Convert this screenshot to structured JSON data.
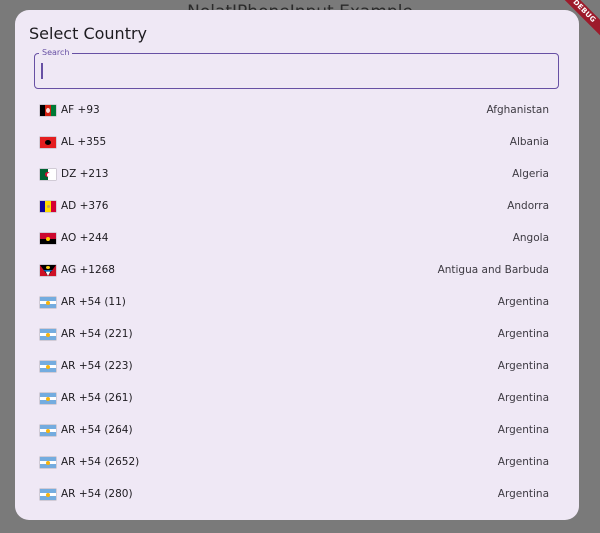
{
  "background": {
    "title": "NolatIPhoneInput Example"
  },
  "debug_banner": {
    "label": "DEBUG"
  },
  "dialog": {
    "title": "Select Country",
    "search": {
      "label": "Search",
      "value": "",
      "placeholder": ""
    },
    "countries": [
      {
        "code": "AF +93",
        "name": "Afghanistan",
        "flag": "af"
      },
      {
        "code": "AL +355",
        "name": "Albania",
        "flag": "al"
      },
      {
        "code": "DZ +213",
        "name": "Algeria",
        "flag": "dz"
      },
      {
        "code": "AD +376",
        "name": "Andorra",
        "flag": "ad"
      },
      {
        "code": "AO +244",
        "name": "Angola",
        "flag": "ao"
      },
      {
        "code": "AG +1268",
        "name": "Antigua and Barbuda",
        "flag": "ag"
      },
      {
        "code": "AR +54 (11)",
        "name": "Argentina",
        "flag": "ar"
      },
      {
        "code": "AR +54 (221)",
        "name": "Argentina",
        "flag": "ar"
      },
      {
        "code": "AR +54 (223)",
        "name": "Argentina",
        "flag": "ar"
      },
      {
        "code": "AR +54 (261)",
        "name": "Argentina",
        "flag": "ar"
      },
      {
        "code": "AR +54 (264)",
        "name": "Argentina",
        "flag": "ar"
      },
      {
        "code": "AR +54 (2652)",
        "name": "Argentina",
        "flag": "ar"
      },
      {
        "code": "AR +54 (280)",
        "name": "Argentina",
        "flag": "ar"
      }
    ]
  },
  "colors": {
    "scrim": "#7a7a7a",
    "dialog_surface": "#efe8f5",
    "accent": "#6750a4",
    "debug_ribbon": "#9d1b2b"
  }
}
